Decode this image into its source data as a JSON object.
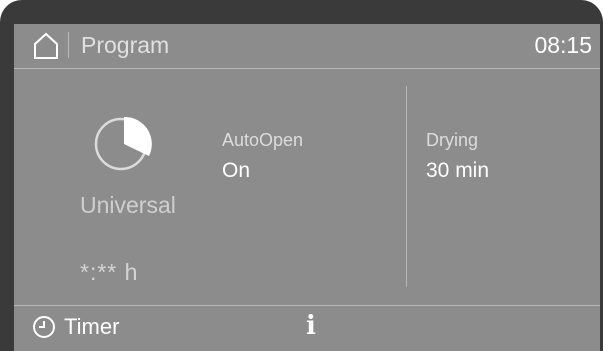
{
  "header": {
    "title": "Program",
    "time": "08:15",
    "home_icon": "home-icon"
  },
  "program": {
    "icon": "pie-chart-icon",
    "name": "Universal",
    "time_remaining": "*:** h"
  },
  "options": [
    {
      "label": "AutoOpen",
      "value": "On"
    },
    {
      "label": "Drying",
      "value": "30 min"
    }
  ],
  "footer": {
    "timer_icon": "clock-icon",
    "timer_label": "Timer",
    "info_icon": "info-icon"
  }
}
